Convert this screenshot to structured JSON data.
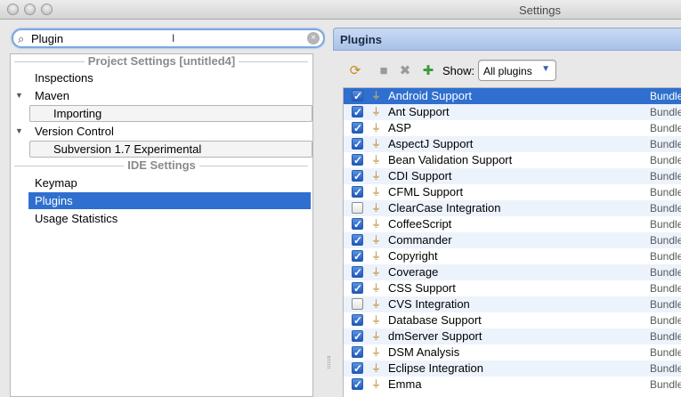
{
  "window": {
    "title": "Settings"
  },
  "search": {
    "value": "Plugin",
    "clear_icon": "×",
    "search_icon": "search-icon"
  },
  "tree": {
    "project_header": "Project Settings [untitled4]",
    "ide_header": "IDE Settings",
    "items": {
      "inspections": "Inspections",
      "maven": "Maven",
      "importing": "Importing",
      "version_control": "Version Control",
      "subversion": "Subversion 1.7 Experimental",
      "keymap": "Keymap",
      "plugins": "Plugins",
      "usage_statistics": "Usage Statistics"
    }
  },
  "plugins_panel": {
    "title": "Plugins",
    "show_label": "Show:",
    "show_value": "All plugins",
    "icons": [
      "reload-icon",
      "install-icon",
      "uninstall-icon",
      "add-plugin-icon"
    ]
  },
  "plugins": [
    {
      "name": "Android Support",
      "enabled": true,
      "source": "Bundle"
    },
    {
      "name": "Ant Support",
      "enabled": true,
      "source": "Bundle"
    },
    {
      "name": "ASP",
      "enabled": true,
      "source": "Bundle"
    },
    {
      "name": "AspectJ Support",
      "enabled": true,
      "source": "Bundle"
    },
    {
      "name": "Bean Validation Support",
      "enabled": true,
      "source": "Bundle"
    },
    {
      "name": "CDI Support",
      "enabled": true,
      "source": "Bundle"
    },
    {
      "name": "CFML Support",
      "enabled": true,
      "source": "Bundle"
    },
    {
      "name": "ClearCase Integration",
      "enabled": false,
      "source": "Bundle"
    },
    {
      "name": "CoffeeScript",
      "enabled": true,
      "source": "Bundle"
    },
    {
      "name": "Commander",
      "enabled": true,
      "source": "Bundle"
    },
    {
      "name": "Copyright",
      "enabled": true,
      "source": "Bundle"
    },
    {
      "name": "Coverage",
      "enabled": true,
      "source": "Bundle"
    },
    {
      "name": "CSS Support",
      "enabled": true,
      "source": "Bundle"
    },
    {
      "name": "CVS Integration",
      "enabled": false,
      "source": "Bundle"
    },
    {
      "name": "Database Support",
      "enabled": true,
      "source": "Bundle"
    },
    {
      "name": "dmServer Support",
      "enabled": true,
      "source": "Bundle"
    },
    {
      "name": "DSM Analysis",
      "enabled": true,
      "source": "Bundle"
    },
    {
      "name": "Eclipse Integration",
      "enabled": true,
      "source": "Bundle"
    },
    {
      "name": "Emma",
      "enabled": true,
      "source": "Bundle"
    }
  ],
  "selected_plugin_index": 0
}
